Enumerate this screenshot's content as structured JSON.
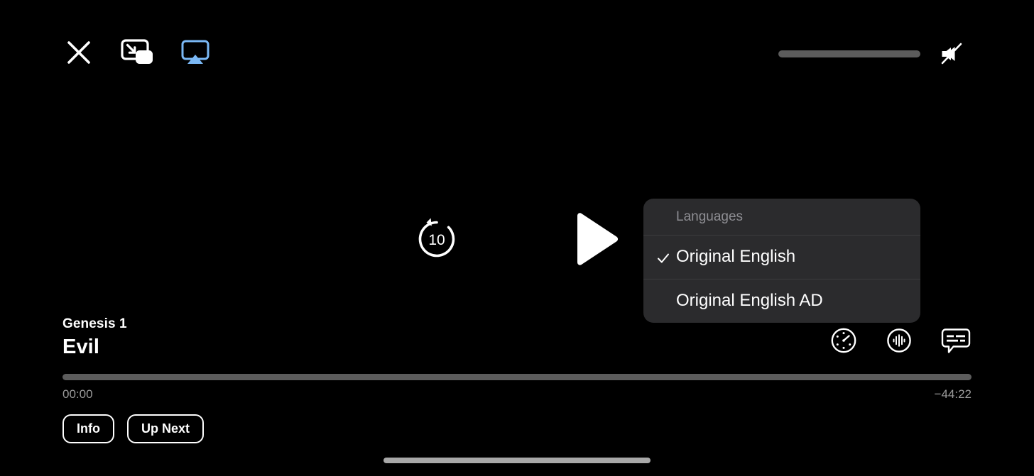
{
  "colors": {
    "background": "#000000",
    "accent_airplay": "#7ab8f5",
    "track_gray": "#5c5c5c",
    "menu_background": "#2b2b2d",
    "menu_header_text": "#8e8e93",
    "time_text": "#9a9a9a",
    "home_indicator": "#a8a8a8"
  },
  "top_bar": {
    "close_label": "close-icon",
    "pip_label": "picture-in-picture-icon",
    "airplay_label": "airplay-icon",
    "volume": {
      "label": "volume-slider",
      "value": 0
    },
    "mute_label": "mute-icon",
    "muted": true
  },
  "transport": {
    "skip_back_label": "skip-back-10-icon",
    "skip_back_seconds": "10",
    "play_label": "play-icon",
    "state": "paused"
  },
  "now_playing": {
    "subtitle": "Genesis 1",
    "title": "Evil"
  },
  "right_controls": [
    {
      "name": "playback-speed-icon",
      "label": "Playback Speed"
    },
    {
      "name": "audio-track-icon",
      "label": "Audio"
    },
    {
      "name": "subtitles-icon",
      "label": "Subtitles"
    }
  ],
  "scrubber": {
    "current_time": "00:00",
    "remaining_time": "−44:22",
    "progress_percent": 0
  },
  "pill_buttons": [
    {
      "label": "Info"
    },
    {
      "label": "Up Next"
    }
  ],
  "languages_menu": {
    "header": "Languages",
    "items": [
      {
        "label": "Original English",
        "selected": true
      },
      {
        "label": "Original English AD",
        "selected": false
      }
    ],
    "check_glyph": "✓"
  },
  "home_indicator": {
    "label": "home-indicator"
  }
}
